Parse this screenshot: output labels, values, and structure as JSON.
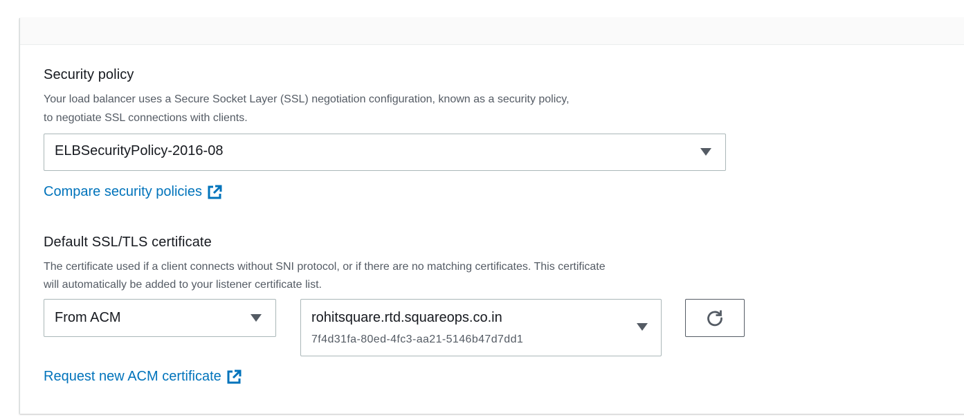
{
  "security_policy": {
    "heading": "Security policy",
    "description_line1": "Your load balancer uses a Secure Socket Layer (SSL) negotiation configuration, known as a security policy,",
    "description_line2": "to negotiate SSL connections with clients.",
    "selected": "ELBSecurityPolicy-2016-08",
    "compare_link": "Compare security policies"
  },
  "certificate": {
    "heading": "Default SSL/TLS certificate",
    "description_line1": "The certificate used if a client connects without SNI protocol, or if there are no matching certificates. This certificate",
    "description_line2": "will automatically be added to your listener certificate list.",
    "source_selected": "From ACM",
    "cert_name": "rohitsquare.rtd.squareops.co.in",
    "cert_id": "7f4d31fa-80ed-4fc3-aa21-5146b47d7dd1",
    "request_link": "Request new ACM certificate"
  },
  "icons": {
    "external_link": "external-link-icon",
    "refresh": "refresh-icon",
    "caret": "caret-down-icon"
  },
  "colors": {
    "link": "#0073bb",
    "text": "#16191f",
    "secondary_text": "#545b64",
    "border": "#aab7b8"
  }
}
